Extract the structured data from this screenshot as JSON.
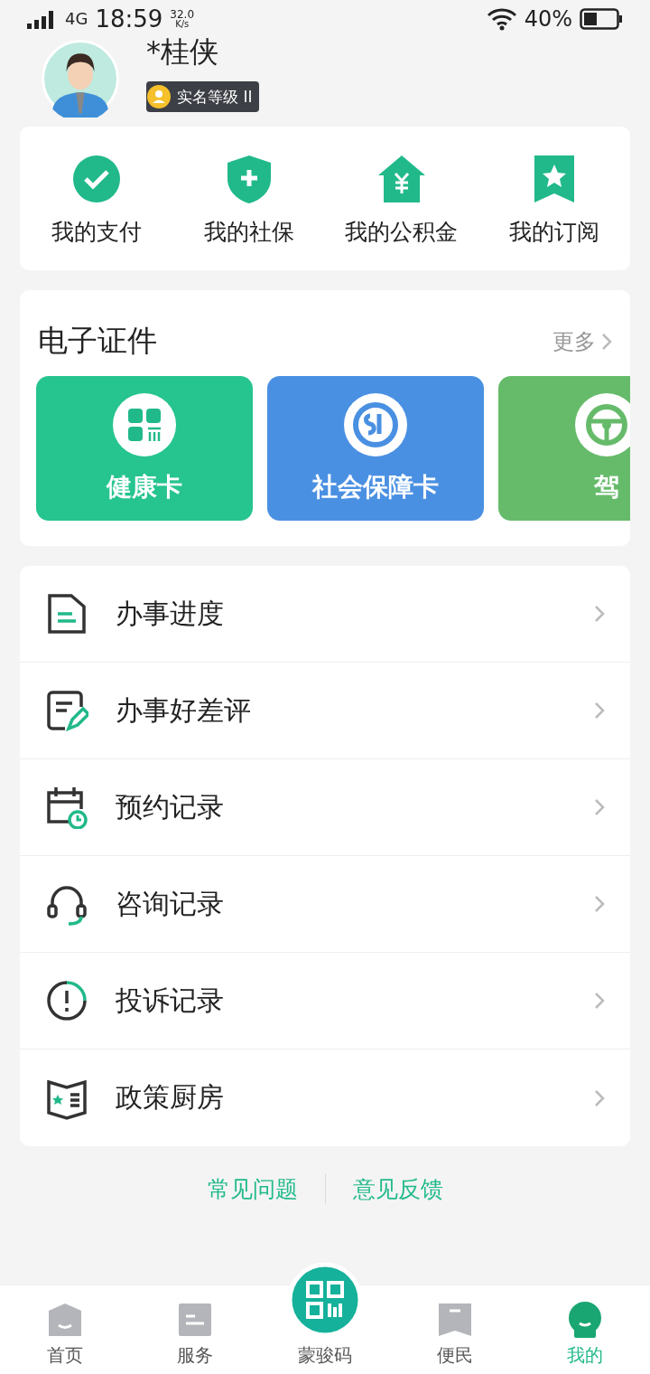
{
  "status_bar": {
    "network": "4G",
    "time": "18:59",
    "speed": "32.0",
    "speed_unit": "K/s",
    "battery": "40%"
  },
  "profile": {
    "name": "*桂侠",
    "badge": "实名等级 II"
  },
  "quick_actions": [
    {
      "kind": "check",
      "label": "我的支付"
    },
    {
      "kind": "shield",
      "label": "我的社保"
    },
    {
      "kind": "house",
      "label": "我的公积金"
    },
    {
      "kind": "bookmark",
      "label": "我的订阅"
    }
  ],
  "certificates": {
    "title": "电子证件",
    "more": "更多",
    "cards": [
      {
        "kind": "health",
        "label": "健康卡",
        "color": "#26c48e"
      },
      {
        "kind": "social",
        "label": "社会保障卡",
        "color": "#4a90e2"
      },
      {
        "kind": "driver",
        "label": "驾",
        "color": "#66bb6a"
      }
    ]
  },
  "menu": [
    {
      "kind": "doc",
      "label": "办事进度"
    },
    {
      "kind": "review",
      "label": "办事好差评"
    },
    {
      "kind": "calendar",
      "label": "预约记录"
    },
    {
      "kind": "headset",
      "label": "咨询记录"
    },
    {
      "kind": "alert",
      "label": "投诉记录"
    },
    {
      "kind": "book",
      "label": "政策厨房"
    }
  ],
  "footer_links": [
    "常见问题",
    "意见反馈"
  ],
  "tabs": [
    {
      "kind": "home",
      "label": "首页",
      "selected": false
    },
    {
      "kind": "service",
      "label": "服务",
      "selected": false
    },
    {
      "kind": "qr",
      "label": "蒙骏码",
      "selected": false
    },
    {
      "kind": "people",
      "label": "便民",
      "selected": false
    },
    {
      "kind": "me",
      "label": "我的",
      "selected": true
    }
  ]
}
